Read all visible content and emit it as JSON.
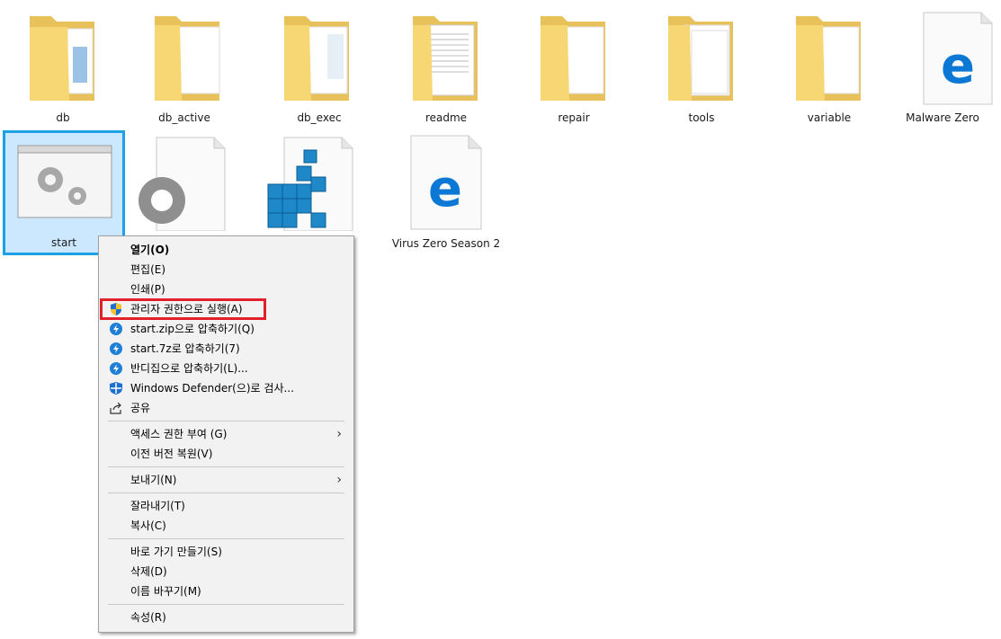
{
  "files": [
    {
      "name": "db",
      "kind": "folder"
    },
    {
      "name": "db_active",
      "kind": "folder"
    },
    {
      "name": "db_exec",
      "kind": "folder"
    },
    {
      "name": "readme",
      "kind": "folder"
    },
    {
      "name": "repair",
      "kind": "folder"
    },
    {
      "name": "tools",
      "kind": "folder"
    },
    {
      "name": "variable",
      "kind": "folder"
    },
    {
      "name": "Malware Zero",
      "kind": "edge-document"
    },
    {
      "name": "start",
      "kind": "batch-file",
      "selected": true
    },
    {
      "name": "",
      "kind": "settings-file"
    },
    {
      "name": "",
      "kind": "registry-file"
    },
    {
      "name": "Virus Zero Season 2",
      "kind": "edge-document"
    }
  ],
  "context_menu": {
    "items": [
      {
        "label": "열기(O)",
        "icon": "",
        "bold": true
      },
      {
        "label": "편집(E)",
        "icon": ""
      },
      {
        "label": "인쇄(P)",
        "icon": ""
      },
      {
        "label": "관리자 권한으로 실행(A)",
        "icon": "uac-shield-icon",
        "highlighted": true
      },
      {
        "label": "start.zip으로 압축하기(Q)",
        "icon": "bandizip-icon"
      },
      {
        "label": "start.7z로 압축하기(7)",
        "icon": "bandizip-icon"
      },
      {
        "label": "반디집으로 압축하기(L)...",
        "icon": "bandizip-icon"
      },
      {
        "label": "Windows Defender(으)로 검사...",
        "icon": "defender-icon"
      },
      {
        "label": "공유",
        "icon": "share-icon"
      },
      {
        "label": "액세스 권한 부여 (G)",
        "icon": "",
        "submenu": true
      },
      {
        "label": "이전 버전 복원(V)",
        "icon": ""
      },
      {
        "label": "보내기(N)",
        "icon": "",
        "submenu": true
      },
      {
        "label": "잘라내기(T)",
        "icon": ""
      },
      {
        "label": "복사(C)",
        "icon": ""
      },
      {
        "label": "바로 가기 만들기(S)",
        "icon": ""
      },
      {
        "label": "삭제(D)",
        "icon": ""
      },
      {
        "label": "이름 바꾸기(M)",
        "icon": ""
      },
      {
        "label": "속성(R)",
        "icon": ""
      }
    ],
    "submenu_arrow": "›"
  },
  "colors": {
    "selection_fill": "#cce8ff",
    "selection_border": "#1ea0e6",
    "highlight_border": "#e0202a",
    "folder": "#f7d774",
    "edge_blue": "#0a78d4"
  }
}
